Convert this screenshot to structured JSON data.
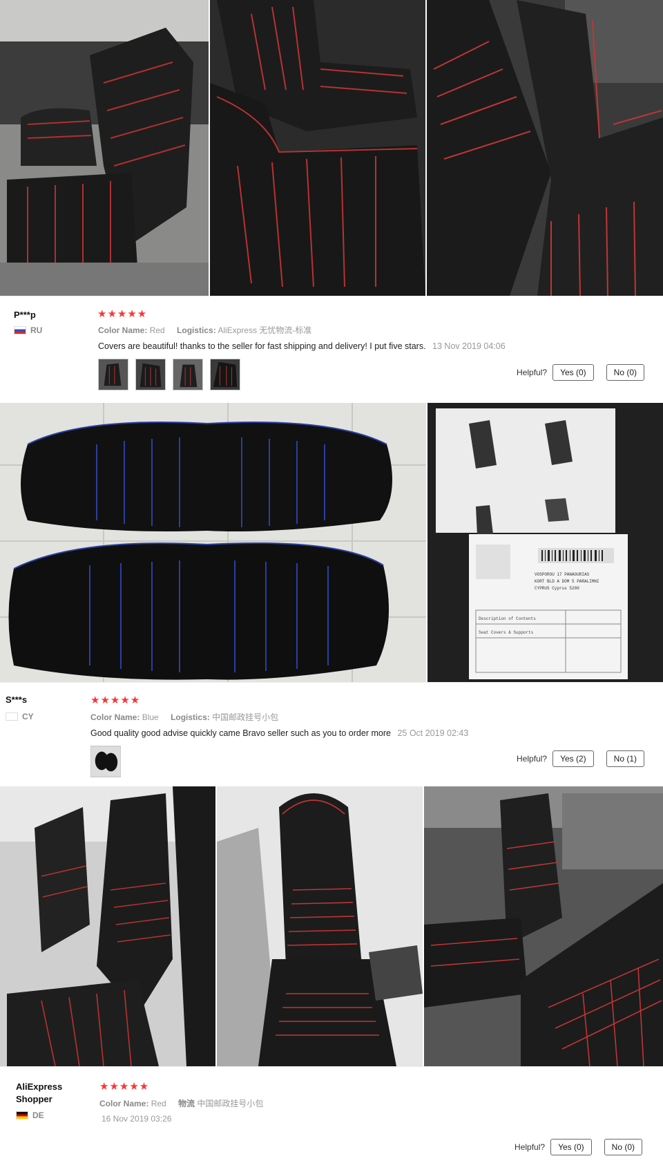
{
  "reviews": [
    {
      "user": "P***p",
      "country": "RU",
      "stars": "★★★★★",
      "color_label": "Color Name:",
      "color": "Red",
      "logistics_label": "Logistics:",
      "logistics": "AliExpress 无忧物流-标准",
      "text": "Covers are beautiful! thanks to the seller for fast shipping and delivery! I put five stars.",
      "date": "13 Nov 2019 04:06",
      "helpful": "Helpful?",
      "yes": "Yes (0)",
      "no": "No (0)"
    },
    {
      "user": "S***s",
      "country": "CY",
      "stars": "★★★★★",
      "color_label": "Color Name:",
      "color": "Blue",
      "logistics_label": "Logistics:",
      "logistics": "中国邮政挂号小包",
      "text": "Good quality good advise quickly came Bravo seller such as you to order more",
      "date": "25 Oct 2019 02:43",
      "helpful": "Helpful?",
      "yes": "Yes (2)",
      "no": "No (1)"
    },
    {
      "user_line1": "AliExpress",
      "user_line2": "Shopper",
      "country": "DE",
      "stars": "★★★★★",
      "color_label": "Color Name:",
      "color": "Red",
      "logistics_label": "物流",
      "logistics": "中国邮政挂号小包",
      "date": "16 Nov 2019 03:26",
      "helpful": "Helpful?",
      "yes": "Yes (0)",
      "no": "No (0)"
    }
  ],
  "package_label": {
    "line1": "VOSPOROU 17 PANAOURIAS",
    "line2": "KORT BLD A DOM 5 PARALIMNI",
    "line3": "CYPRUS Cyprus 5280",
    "desc": "Description of Contents",
    "item": "Seat Covers & Supports"
  }
}
